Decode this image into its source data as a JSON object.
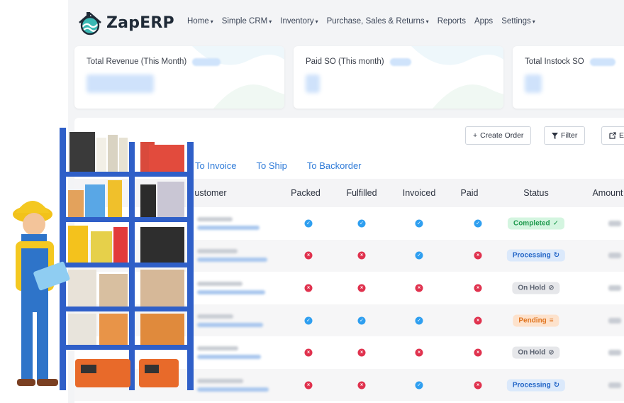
{
  "app": {
    "name": "ZapERP"
  },
  "nav": [
    {
      "label": "Home",
      "has_caret": true
    },
    {
      "label": "Simple CRM",
      "has_caret": true
    },
    {
      "label": "Inventory",
      "has_caret": true
    },
    {
      "label": "Purchase, Sales & Returns",
      "has_caret": true
    },
    {
      "label": "Reports",
      "has_caret": false
    },
    {
      "label": "Apps",
      "has_caret": false
    },
    {
      "label": "Settings",
      "has_caret": true
    }
  ],
  "cards": [
    {
      "title": "Total Revenue (This Month)"
    },
    {
      "title": "Paid SO (This month)"
    },
    {
      "title": "Total Instock SO"
    }
  ],
  "toolbar": {
    "create_order": "Create Order",
    "filter": "Filter",
    "export_partial": "E"
  },
  "tabs": [
    "To Invoice",
    "To Ship",
    "To Backorder"
  ],
  "table": {
    "headers": {
      "customer": "ustomer",
      "packed": "Packed",
      "fulfilled": "Fulfilled",
      "invoiced": "Invoiced",
      "paid": "Paid",
      "status": "Status",
      "amount": "Amount"
    },
    "rows": [
      {
        "packed": true,
        "fulfilled": true,
        "invoiced": true,
        "paid": true,
        "status": "Completed",
        "status_icon": "check-icon"
      },
      {
        "packed": false,
        "fulfilled": false,
        "invoiced": true,
        "paid": false,
        "status": "Processing",
        "status_icon": "refresh-icon"
      },
      {
        "packed": false,
        "fulfilled": false,
        "invoiced": false,
        "paid": false,
        "status": "On Hold",
        "status_icon": "ban-icon"
      },
      {
        "packed": true,
        "fulfilled": true,
        "invoiced": true,
        "paid": false,
        "status": "Pending",
        "status_icon": "list-icon"
      },
      {
        "packed": false,
        "fulfilled": false,
        "invoiced": false,
        "paid": false,
        "status": "On Hold",
        "status_icon": "ban-icon"
      },
      {
        "packed": false,
        "fulfilled": false,
        "invoiced": true,
        "paid": false,
        "status": "Processing",
        "status_icon": "refresh-icon"
      }
    ]
  },
  "status_styles": {
    "Completed": {
      "bg": "#d4f5e0",
      "fg": "#1f9a4e",
      "glyph": "✓"
    },
    "Processing": {
      "bg": "#dbe9fb",
      "fg": "#2567c7",
      "glyph": "↻"
    },
    "On Hold": {
      "bg": "#e6e7ea",
      "fg": "#5b6270",
      "glyph": "⊘"
    },
    "Pending": {
      "bg": "#fde2cc",
      "fg": "#e0741f",
      "glyph": "≡"
    }
  },
  "colors": {
    "accent": "#2f7bd8",
    "ok": "#2f9ff0",
    "no": "#e0324e"
  }
}
